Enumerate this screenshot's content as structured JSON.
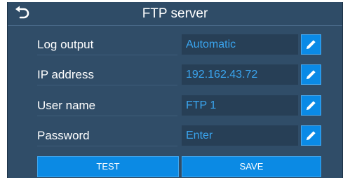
{
  "header": {
    "title": "FTP server",
    "back_icon": "back-arrow-icon"
  },
  "settings": [
    {
      "label": "Log output",
      "value": "Automatic",
      "icon": "pencil-icon"
    },
    {
      "label": "IP address",
      "value": "192.162.43.72",
      "icon": "pencil-icon"
    },
    {
      "label": "User name",
      "value": "FTP 1",
      "icon": "pencil-icon"
    },
    {
      "label": "Password",
      "value": "Enter",
      "icon": "pencil-icon"
    }
  ],
  "buttons": {
    "test_label": "TEST",
    "save_label": "SAVE"
  },
  "colors": {
    "background": "#304d68",
    "field_background": "#273f56",
    "field_text": "#3aa4ee",
    "accent_button": "#0a8ae6"
  }
}
